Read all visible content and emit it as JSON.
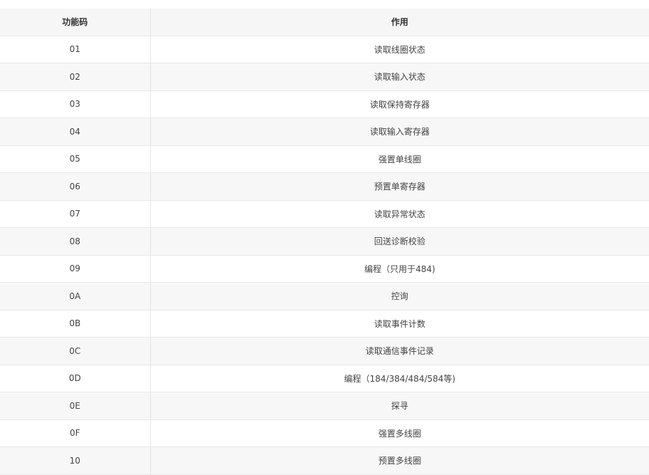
{
  "table": {
    "headers": [
      "功能码",
      "作用"
    ],
    "rows": [
      [
        "01",
        "读取线圈状态"
      ],
      [
        "02",
        "读取输入状态"
      ],
      [
        "03",
        "读取保持寄存器"
      ],
      [
        "04",
        "读取输入寄存器"
      ],
      [
        "05",
        "强置单线圈"
      ],
      [
        "06",
        "预置单寄存器"
      ],
      [
        "07",
        "读取异常状态"
      ],
      [
        "08",
        "回送诊断校验"
      ],
      [
        "09",
        "编程（只用于484)"
      ],
      [
        "0A",
        "控询"
      ],
      [
        "0B",
        "读取事件计数"
      ],
      [
        "0C",
        "读取通信事件记录"
      ],
      [
        "0D",
        "编程（184/384/484/584等)"
      ],
      [
        "0E",
        "探寻"
      ],
      [
        "0F",
        "强置多线圈"
      ],
      [
        "10",
        "预置多线圈"
      ]
    ]
  }
}
